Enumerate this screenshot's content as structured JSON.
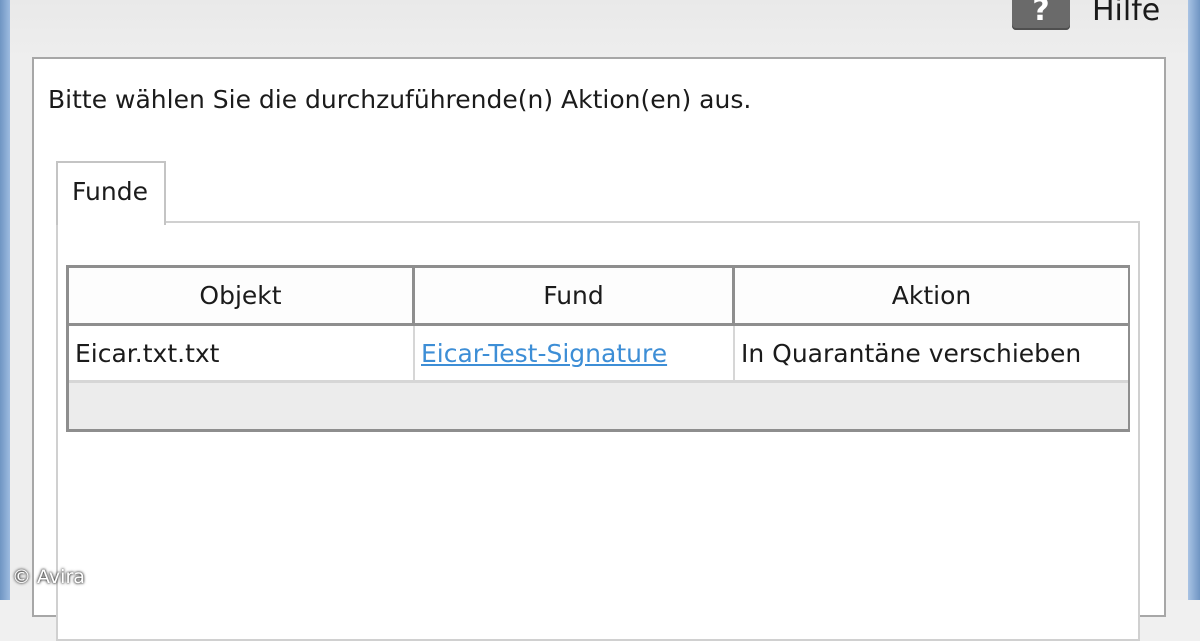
{
  "help": {
    "label": "Hilfe",
    "icon": "help-question-icon"
  },
  "instruction": "Bitte wählen Sie die durchzuführende(n) Aktion(en) aus.",
  "tabs": [
    {
      "label": "Funde",
      "selected": true
    }
  ],
  "table": {
    "columns": [
      "Objekt",
      "Fund",
      "Aktion"
    ],
    "rows": [
      {
        "objekt": "Eicar.txt.txt",
        "fund": "Eicar-Test-Signature",
        "aktion": "In Quarantäne verschieben"
      }
    ]
  },
  "watermark": "© Avira",
  "colors": {
    "link": "#3d8ed6",
    "frame": "#7fa5d2",
    "help_icon_bg": "#6a6a6a"
  }
}
